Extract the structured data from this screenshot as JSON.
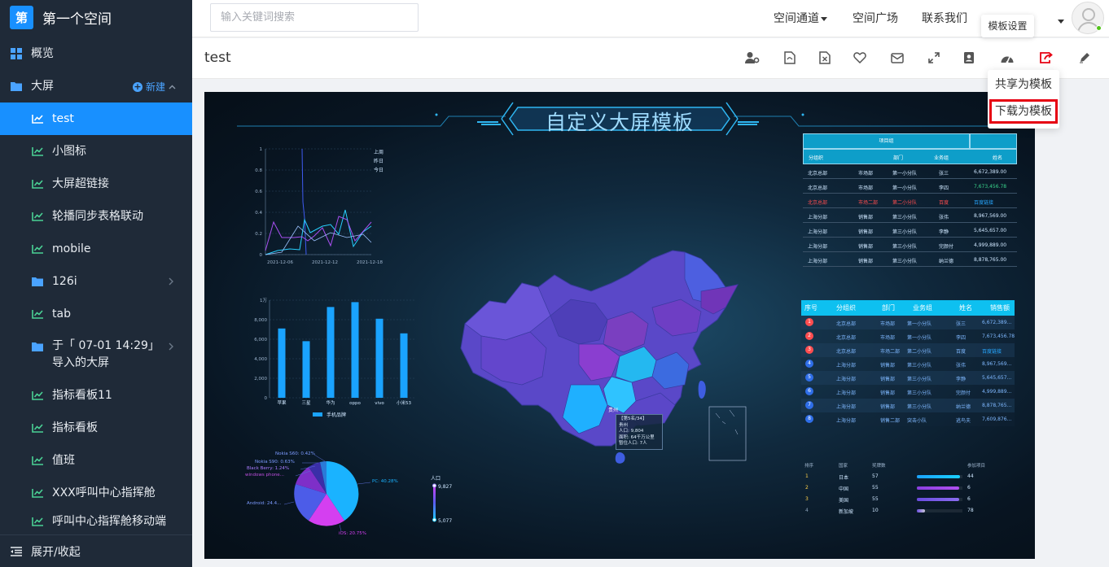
{
  "app": {
    "logo_char": "第",
    "space_name": "第一个空间"
  },
  "sidebar": {
    "items": [
      {
        "label": "概览",
        "icon": "grid-icon",
        "level": 1
      },
      {
        "label": "大屏",
        "icon": "folder-icon",
        "level": 1,
        "new_label": "新建"
      },
      {
        "label": "test",
        "icon": "chart-icon",
        "level": 2,
        "active": true
      },
      {
        "label": "小图标",
        "icon": "chart-icon",
        "level": 2
      },
      {
        "label": "大屏超链接",
        "icon": "chart-icon",
        "level": 2
      },
      {
        "label": "轮播同步表格联动",
        "icon": "chart-icon",
        "level": 2
      },
      {
        "label": "mobile",
        "icon": "chart-icon",
        "level": 2
      },
      {
        "label": "126i",
        "icon": "folder-icon",
        "level": 2
      },
      {
        "label": "tab",
        "icon": "chart-icon",
        "level": 2
      },
      {
        "label": "于「 07-01 14:29」导入的大屏",
        "icon": "folder-icon",
        "level": 2
      },
      {
        "label": "指标看板11",
        "icon": "chart-icon",
        "level": 2
      },
      {
        "label": "指标看板",
        "icon": "chart-icon",
        "level": 2
      },
      {
        "label": "值班",
        "icon": "chart-icon",
        "level": 2
      },
      {
        "label": "XXX呼叫中心指挥舱",
        "icon": "chart-icon",
        "level": 2
      },
      {
        "label": "呼叫中心指挥舱移动端",
        "icon": "chart-icon",
        "level": 2
      }
    ],
    "footer_label": "展开/收起"
  },
  "header": {
    "search_placeholder": "输入关键词搜索",
    "nav": [
      "空间通道",
      "空间广场",
      "联系我们"
    ]
  },
  "toolbar": {
    "title": "test",
    "tools": [
      "user-gear-icon",
      "file-pdf-icon",
      "file-excel-icon",
      "heart-icon",
      "envelope-icon",
      "expand-icon",
      "contact-card-icon",
      "dashboard-icon",
      "share-icon",
      "pencil-icon"
    ],
    "tooltip": "模板设置",
    "dropdown": [
      "共享为模板",
      "下载为模板"
    ]
  },
  "screen": {
    "title": "自定义大屏模板",
    "line_legend": [
      "上周",
      "昨日",
      "今日"
    ],
    "line_x": [
      "2021-12-06",
      "2021-12-12",
      "2021-12-18"
    ],
    "line_y": [
      "1",
      "0.8",
      "0.6",
      "0.4",
      "0.2",
      "0"
    ],
    "bar_y": [
      "1万",
      "8,000",
      "6,000",
      "4,000",
      "2,000",
      "0"
    ],
    "bar_legend": "手机品牌",
    "bar_categories": [
      "苹果",
      "三星",
      "华为",
      "oppo",
      "vivo",
      "小米53"
    ],
    "bar_values": [
      7100,
      5800,
      9300,
      9800,
      8100,
      6600
    ],
    "pie_labels": [
      "Nokia S60: 0.42%",
      "Nokia S90: 0.63%",
      "Black Berry: 1.24%",
      "windows phone...",
      "Android: 24.4...",
      "PC: 40.28%",
      "iOS: 20.75%"
    ],
    "legend_pop_title": "人口",
    "legend_pop_max": "9,827",
    "legend_pop_min": "5,077",
    "map_tooltip": [
      "【第5名/34】",
      "贵州",
      "人口: 9,804",
      "面积: 64千万公里",
      "暂住人口: 7人"
    ],
    "map_label": "贵州",
    "table1": {
      "group_header": "项目组",
      "headers": [
        "分组织",
        "部门",
        "业务组",
        "姓名"
      ],
      "rows": [
        [
          "北京总部",
          "市场部",
          "第一小分队",
          "张三",
          "6,672,389.00"
        ],
        [
          "北京总部",
          "市场部",
          "第一小分队",
          "李四",
          "7,673,456.78"
        ],
        [
          "北京总部",
          "市场二部",
          "第二小分队",
          "百度",
          "百度链接"
        ],
        [
          "上海分部",
          "销售部",
          "第三小分队",
          "张伟",
          "8,967,569.00"
        ],
        [
          "上海分部",
          "销售部",
          "第三小分队",
          "李静",
          "5,645,657.00"
        ],
        [
          "上海分部",
          "销售部",
          "第三小分队",
          "完颜付",
          "4,999,889.00"
        ],
        [
          "上海分部",
          "销售部",
          "第三小分队",
          "纳兰德",
          "8,878,765.00"
        ]
      ]
    },
    "table2": {
      "headers": [
        "序号",
        "分组织",
        "部门",
        "业务组",
        "姓名",
        "销售额"
      ],
      "rows": [
        [
          "1",
          "北京总部",
          "市场部",
          "第一小分队",
          "张三",
          "6,672,389..."
        ],
        [
          "2",
          "北京总部",
          "市场部",
          "第一小分队",
          "李四",
          "7,673,456.78"
        ],
        [
          "3",
          "北京总部",
          "市场二部",
          "第二小分队",
          "百度",
          "百度链接"
        ],
        [
          "4",
          "上海分部",
          "销售部",
          "第三小分队",
          "张伟",
          "8,967,569..."
        ],
        [
          "5",
          "上海分部",
          "销售部",
          "第三小分队",
          "李静",
          "5,645,657..."
        ],
        [
          "6",
          "上海分部",
          "销售部",
          "第三小分队",
          "完颜付",
          "4,999,889..."
        ],
        [
          "7",
          "上海分部",
          "销售部",
          "第三小分队",
          "纳兰德",
          "8,878,765..."
        ],
        [
          "8",
          "上海分部",
          "销售二部",
          "突击小队",
          "逃鸟夫",
          "7,609,876..."
        ]
      ]
    },
    "rank": {
      "headers": [
        "排序",
        "国家",
        "奖牌数",
        "参加项目"
      ],
      "rows": [
        {
          "rank": "1",
          "country": "日本",
          "medals": "57",
          "events": "44",
          "fill": 0.95
        },
        {
          "rank": "2",
          "country": "中国",
          "medals": "55",
          "events": "6",
          "fill": 0.92
        },
        {
          "rank": "3",
          "country": "美国",
          "medals": "55",
          "events": "6",
          "fill": 0.92
        },
        {
          "rank": "4",
          "country": "新加坡",
          "medals": "10",
          "events": "78",
          "fill": 0.17
        }
      ]
    }
  }
}
